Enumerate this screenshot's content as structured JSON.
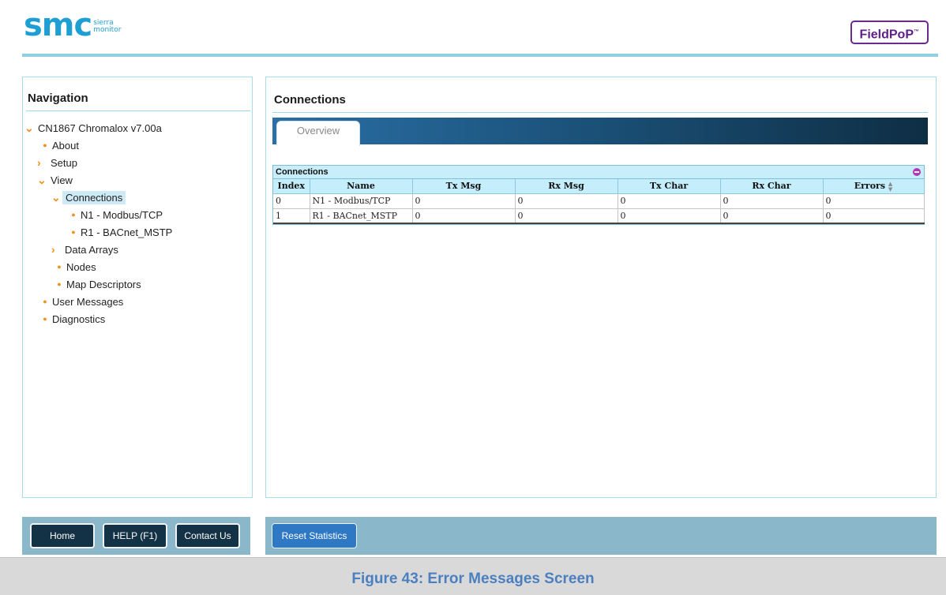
{
  "header": {
    "logo_main": "smc",
    "logo_sub_line1": "sierra",
    "logo_sub_line2": "monitor",
    "brand_badge": "FieldPoP",
    "brand_tm": "™"
  },
  "navigation": {
    "title": "Navigation",
    "items": [
      {
        "label": "CN1867 Chromalox v7.00a",
        "type": "expanded"
      },
      {
        "label": "About",
        "type": "leaf"
      },
      {
        "label": "Setup",
        "type": "collapsed"
      },
      {
        "label": "View",
        "type": "expanded"
      },
      {
        "label": "Connections",
        "type": "expanded",
        "selected": true
      },
      {
        "label": "N1 - Modbus/TCP",
        "type": "leaf"
      },
      {
        "label": "R1 - BACnet_MSTP",
        "type": "leaf"
      },
      {
        "label": "Data Arrays",
        "type": "collapsed"
      },
      {
        "label": "Nodes",
        "type": "leaf"
      },
      {
        "label": "Map Descriptors",
        "type": "leaf"
      },
      {
        "label": "User Messages",
        "type": "leaf"
      },
      {
        "label": "Diagnostics",
        "type": "leaf"
      }
    ]
  },
  "content": {
    "title": "Connections",
    "tabs": [
      {
        "label": "Overview"
      }
    ],
    "grid": {
      "caption": "Connections",
      "columns": [
        "Index",
        "Name",
        "Tx Msg",
        "Rx Msg",
        "Tx Char",
        "Rx Char",
        "Errors"
      ],
      "rows": [
        [
          "0",
          "N1 - Modbus/TCP",
          "0",
          "0",
          "0",
          "0",
          "0"
        ],
        [
          "1",
          "R1 - BACnet_MSTP",
          "0",
          "0",
          "0",
          "0",
          "0"
        ]
      ]
    }
  },
  "footer": {
    "home_label": "Home",
    "help_label": "HELP (F1)",
    "contact_label": "Contact Us",
    "reset_label": "Reset Statistics"
  },
  "figure_caption": "Figure 43: Error Messages Screen",
  "colors": {
    "accent": "#1d9fd4",
    "brand_purple": "#5e1f8a",
    "tree_marker": "#f0901e",
    "footer_bar": "#8ab7ca",
    "button_dark": "#143246",
    "button_blue": "#2f78c4",
    "caption_blue": "#4a7fc0"
  }
}
